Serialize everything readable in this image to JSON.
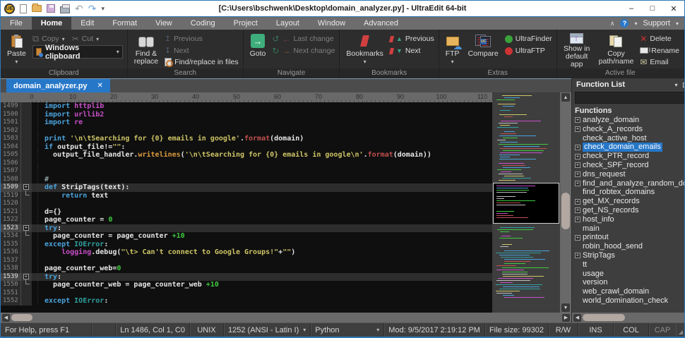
{
  "window": {
    "title": "[C:\\Users\\bschwenk\\Desktop\\domain_analyzer.py] - UltraEdit 64-bit",
    "controls": {
      "minimize": "–",
      "maximize": "□",
      "close": "✕"
    }
  },
  "menubar": {
    "items": [
      "File",
      "Home",
      "Edit",
      "Format",
      "View",
      "Coding",
      "Project",
      "Layout",
      "Window",
      "Advanced"
    ],
    "active": "Home",
    "support": "Support"
  },
  "ribbon": {
    "clipboard": {
      "label": "Clipboard",
      "paste": "Paste",
      "copy": "Copy",
      "cut": "Cut",
      "windows_clipboard": "Windows clipboard"
    },
    "search": {
      "label": "Search",
      "find_replace_1": "Find &",
      "find_replace_2": "replace",
      "previous": "Previous",
      "next": "Next",
      "find_in_files": "Find/replace in files"
    },
    "navigate": {
      "label": "Navigate",
      "goto": "Goto",
      "last_change": "Last change",
      "next_change": "Next change"
    },
    "bookmarks": {
      "label": "Bookmarks",
      "bookmarks": "Bookmarks",
      "previous": "Previous",
      "next": "Next"
    },
    "extras": {
      "label": "Extras",
      "ftp": "FTP",
      "compare": "Compare",
      "ultrafinder": "UltraFinder",
      "ultraftp": "UltraFTP"
    },
    "active_file": {
      "label": "Active file",
      "show_1": "Show in",
      "show_2": "default app",
      "copy_1": "Copy",
      "copy_2": "path/name",
      "delete": "Delete",
      "rename": "Rename",
      "email": "Email"
    }
  },
  "tab": {
    "label": "domain_analyzer.py",
    "close": "✕"
  },
  "ruler": {
    "labels": [
      "0",
      "10",
      "20",
      "30",
      "40",
      "50",
      "60",
      "70",
      "80",
      "90",
      "100",
      "110"
    ]
  },
  "editor": {
    "lines": [
      {
        "num": "1499",
        "fold": "",
        "hl": false,
        "segs": [
          [
            "k",
            "import "
          ],
          [
            "m",
            "httplib"
          ]
        ]
      },
      {
        "num": "1500",
        "fold": "",
        "hl": false,
        "segs": [
          [
            "k",
            "import "
          ],
          [
            "m",
            "urllib2"
          ]
        ]
      },
      {
        "num": "1501",
        "fold": "",
        "hl": false,
        "segs": [
          [
            "k",
            "import "
          ],
          [
            "m",
            "re"
          ]
        ]
      },
      {
        "num": "1502",
        "fold": "",
        "hl": false,
        "segs": []
      },
      {
        "num": "1503",
        "fold": "",
        "hl": false,
        "segs": [
          [
            "k",
            "print "
          ],
          [
            "s",
            "'\\n\\tSearching for {0} emails in google'"
          ],
          [
            "p",
            "."
          ],
          [
            "f",
            "format"
          ],
          [
            "p",
            "(domain)"
          ]
        ]
      },
      {
        "num": "1504",
        "fold": "",
        "hl": false,
        "segs": [
          [
            "k",
            "if "
          ],
          [
            "p",
            "output_file!="
          ],
          [
            "s",
            "\"\""
          ],
          [
            "p",
            ":"
          ]
        ]
      },
      {
        "num": "1505",
        "fold": "",
        "hl": false,
        "segs": [
          [
            "p",
            "  output_file_handler."
          ],
          [
            "o",
            "writelines"
          ],
          [
            "p",
            "("
          ],
          [
            "s",
            "'\\n\\tSearching for {0} emails in google\\n'"
          ],
          [
            "p",
            "."
          ],
          [
            "f",
            "format"
          ],
          [
            "p",
            "(domain))"
          ]
        ]
      },
      {
        "num": "1506",
        "fold": "",
        "hl": false,
        "segs": []
      },
      {
        "num": "1507",
        "fold": "",
        "hl": false,
        "segs": []
      },
      {
        "num": "1508",
        "fold": "",
        "hl": false,
        "segs": [
          [
            "c",
            "#"
          ]
        ]
      },
      {
        "num": "1509",
        "fold": "plus",
        "hl": true,
        "segs": [
          [
            "k",
            "def "
          ],
          [
            "p",
            "StripTags(text):"
          ]
        ]
      },
      {
        "num": "1519",
        "fold": "end",
        "hl": false,
        "segs": [
          [
            "p",
            "    "
          ],
          [
            "k",
            "return "
          ],
          [
            "p",
            "text"
          ]
        ]
      },
      {
        "num": "1520",
        "fold": "",
        "hl": false,
        "segs": []
      },
      {
        "num": "1521",
        "fold": "",
        "hl": false,
        "segs": [
          [
            "p",
            "d={}"
          ]
        ]
      },
      {
        "num": "1522",
        "fold": "",
        "hl": false,
        "segs": [
          [
            "p",
            "page_counter = "
          ],
          [
            "n",
            "0"
          ]
        ]
      },
      {
        "num": "1523",
        "fold": "plus",
        "hl": true,
        "segs": [
          [
            "k",
            "try"
          ],
          [
            "p",
            ":"
          ]
        ]
      },
      {
        "num": "1534",
        "fold": "end",
        "hl": false,
        "segs": [
          [
            "p",
            "  page_counter = page_counter "
          ],
          [
            "n",
            "+10"
          ]
        ]
      },
      {
        "num": "1535",
        "fold": "",
        "hl": false,
        "segs": [
          [
            "k",
            "except "
          ],
          [
            "t",
            "IOError"
          ],
          [
            "p",
            ":"
          ]
        ]
      },
      {
        "num": "1536",
        "fold": "",
        "hl": false,
        "segs": [
          [
            "p",
            "    "
          ],
          [
            "m",
            "logging"
          ],
          [
            "p",
            ".debug("
          ],
          [
            "s",
            "\"\\t> Can't connect to Google Groups!\""
          ],
          [
            "p",
            "+"
          ],
          [
            "s",
            "\"\""
          ],
          [
            "p",
            ")"
          ]
        ]
      },
      {
        "num": "1537",
        "fold": "",
        "hl": false,
        "segs": []
      },
      {
        "num": "1538",
        "fold": "",
        "hl": false,
        "segs": [
          [
            "p",
            "page_counter_web="
          ],
          [
            "n",
            "0"
          ]
        ]
      },
      {
        "num": "1539",
        "fold": "plus",
        "hl": true,
        "segs": [
          [
            "k",
            "try"
          ],
          [
            "p",
            ":"
          ]
        ]
      },
      {
        "num": "1550",
        "fold": "end",
        "hl": false,
        "segs": [
          [
            "p",
            "  page_counter_web = page_counter_web "
          ],
          [
            "n",
            "+10"
          ]
        ]
      },
      {
        "num": "1551",
        "fold": "",
        "hl": false,
        "segs": []
      },
      {
        "num": "1552",
        "fold": "",
        "hl": false,
        "segs": [
          [
            "k",
            "except "
          ],
          [
            "t",
            "IOError"
          ],
          [
            "p",
            ":"
          ]
        ]
      }
    ]
  },
  "function_list": {
    "title": "Function List",
    "header": "Functions",
    "items": [
      {
        "label": "analyze_domain",
        "expand": true,
        "selected": false
      },
      {
        "label": "check_A_records",
        "expand": true,
        "selected": false
      },
      {
        "label": "check_active_host",
        "expand": false,
        "selected": false
      },
      {
        "label": "check_domain_emails",
        "expand": true,
        "selected": true
      },
      {
        "label": "check_PTR_record",
        "expand": true,
        "selected": false
      },
      {
        "label": "check_SPF_record",
        "expand": true,
        "selected": false
      },
      {
        "label": "dns_request",
        "expand": true,
        "selected": false
      },
      {
        "label": "find_and_analyze_random_domain",
        "expand": true,
        "selected": false
      },
      {
        "label": "find_robtex_domains",
        "expand": false,
        "selected": false
      },
      {
        "label": "get_MX_records",
        "expand": true,
        "selected": false
      },
      {
        "label": "get_NS_records",
        "expand": true,
        "selected": false
      },
      {
        "label": "host_info",
        "expand": true,
        "selected": false
      },
      {
        "label": "main",
        "expand": false,
        "selected": false
      },
      {
        "label": "printout",
        "expand": true,
        "selected": false
      },
      {
        "label": "robin_hood_send",
        "expand": false,
        "selected": false
      },
      {
        "label": "StripTags",
        "expand": true,
        "selected": false
      },
      {
        "label": "tt",
        "expand": false,
        "selected": false
      },
      {
        "label": "usage",
        "expand": false,
        "selected": false
      },
      {
        "label": "version",
        "expand": false,
        "selected": false
      },
      {
        "label": "web_crawl_domain",
        "expand": false,
        "selected": false
      },
      {
        "label": "world_domination_check",
        "expand": false,
        "selected": false
      }
    ]
  },
  "statusbar": {
    "help": "For Help, press F1",
    "position": "Ln 1486, Col 1, C0",
    "line_ending": "UNIX",
    "encoding": "1252  (ANSI - Latin I)",
    "syntax": "Python",
    "modified": "Mod: 9/5/2017 2:19:12 PM",
    "file_size": "File size: 99302",
    "readwrite": "R/W",
    "insert_mode": "INS",
    "column_mode": "COL",
    "caps": "CAP"
  },
  "colors": {
    "accent_blue": "#2677c8",
    "window_border": "#2e77b8",
    "editor_bg": "#0f0f0f",
    "keyword": "#4aa3dd",
    "string": "#cec566",
    "number": "#3fca3f",
    "module": "#c84fc8",
    "tab_active_bg": "#2677c8",
    "selection_bg": "#2677c8"
  }
}
